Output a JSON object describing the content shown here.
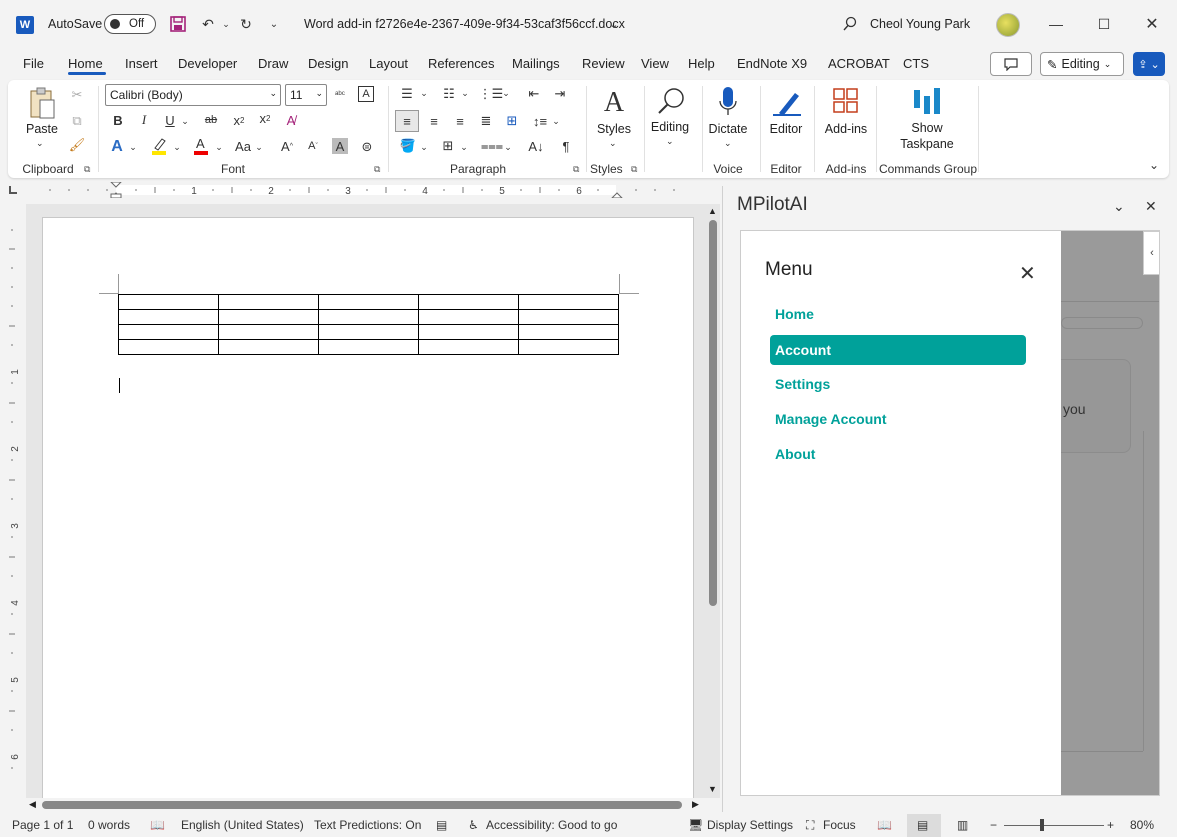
{
  "titlebar": {
    "autosave_label": "AutoSave",
    "autosave_state": "Off",
    "doc_title": "Word add-in f2726e4e-2367-409e-9f34-53caf3f56ccf.docx",
    "user_name": "Cheol Young Park",
    "word_logo": "W"
  },
  "tabs": [
    "File",
    "Home",
    "Insert",
    "Developer",
    "Draw",
    "Design",
    "Layout",
    "References",
    "Mailings",
    "Review",
    "View",
    "Help",
    "EndNote X9",
    "ACROBAT",
    "CTS"
  ],
  "active_tab": "Home",
  "top_right": {
    "editing_label": "Editing"
  },
  "ribbon": {
    "clipboard": {
      "paste_label": "Paste",
      "group_label": "Clipboard"
    },
    "font": {
      "font_name": "Calibri (Body)",
      "font_size": "11",
      "group_label": "Font"
    },
    "paragraph": {
      "group_label": "Paragraph"
    },
    "styles": {
      "styles_label": "Styles",
      "group_label": "Styles"
    },
    "editing": {
      "label": "Editing"
    },
    "voice": {
      "dictate_label": "Dictate",
      "group_label": "Voice"
    },
    "editor": {
      "label": "Editor",
      "group_label": "Editor"
    },
    "addins": {
      "label": "Add-ins",
      "group_label": "Add-ins"
    },
    "commands": {
      "label_line1": "Show",
      "label_line2": "Taskpane",
      "group_label": "Commands Group"
    }
  },
  "ruler_numbers": [
    "1",
    "2",
    "3",
    "4",
    "5",
    "6"
  ],
  "vruler_numbers": [
    "1",
    "2",
    "3",
    "4",
    "5",
    "6"
  ],
  "taskpane": {
    "title": "MPilotAI",
    "menu_title": "Menu",
    "menu_items": [
      {
        "label": "Home",
        "active": false
      },
      {
        "label": "Account",
        "active": true
      },
      {
        "label": "Settings",
        "active": false
      },
      {
        "label": "Manage Account",
        "active": false
      },
      {
        "label": "About",
        "active": false
      }
    ],
    "background_text": "you"
  },
  "statusbar": {
    "page": "Page 1 of 1",
    "words": "0 words",
    "language": "English (United States)",
    "text_predictions": "Text Predictions: On",
    "accessibility": "Accessibility: Good to go",
    "display_settings": "Display Settings",
    "focus": "Focus",
    "zoom": "80%"
  },
  "colors": {
    "accent": "#00a19a",
    "word_blue": "#185abd"
  }
}
